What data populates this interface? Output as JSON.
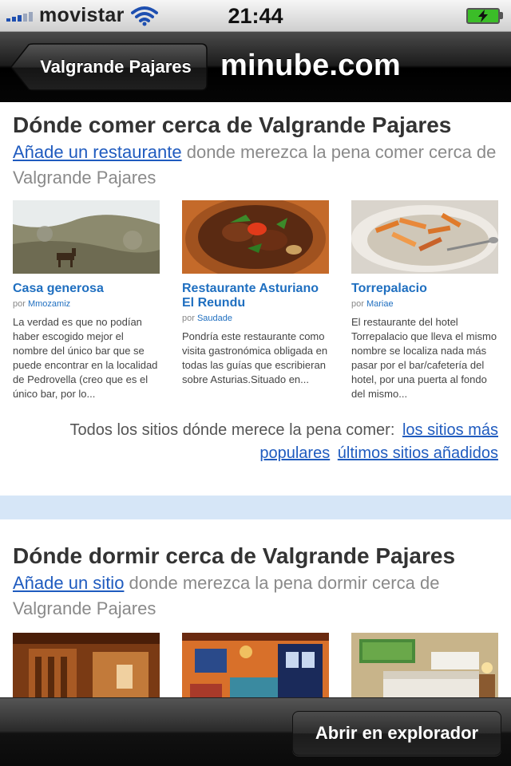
{
  "status_bar": {
    "carrier": "movistar",
    "time": "21:44",
    "signal_bars": 3,
    "icons": [
      "signal-icon",
      "wifi-icon",
      "battery-charging-icon"
    ]
  },
  "nav": {
    "back_label": "Valgrande Pajares",
    "title": "minube.com"
  },
  "eat": {
    "heading": "Dónde comer cerca de Valgrande Pajares",
    "lead_link": "Añade un restaurante",
    "lead_text": " donde merezca la pena comer cerca de Valgrande Pajares",
    "cards": [
      {
        "title": "Casa generosa",
        "by": "por",
        "author": "Mmozamiz",
        "text": "La verdad es que no podían haber escogido mejor el nombre del único bar que se puede encontrar en la localidad de Pedrovella (creo que es el único bar, por lo..."
      },
      {
        "title": "Restaurante Asturiano El Reundu",
        "by": "por",
        "author": "Saudade",
        "text": "Pondría este restaurante como visita gastronómica obligada en todas las guías que escribieran sobre Asturias.Situado en..."
      },
      {
        "title": "Torrepalacio",
        "by": "por",
        "author": "Mariae",
        "text": "El restaurante del hotel Torrepalacio que lleva el mismo nombre se localiza nada más pasar por el bar/cafetería del hotel, por una puerta al fondo del mismo..."
      }
    ],
    "more_text": "Todos los sitios dónde merece la pena comer:",
    "more_link_popular": "los sitios más populares",
    "more_link_recent": "últimos sitios añadidos"
  },
  "sleep": {
    "heading": "Dónde dormir cerca de Valgrande Pajares",
    "lead_link": "Añade un sitio",
    "lead_text": " donde merezca la pena dormir cerca de Valgrande Pajares"
  },
  "toolbar": {
    "open_label": "Abrir en explorador"
  },
  "colors": {
    "link": "#1f5bbf",
    "card_title": "#1f6fc0",
    "band": "#d6e6f7"
  }
}
